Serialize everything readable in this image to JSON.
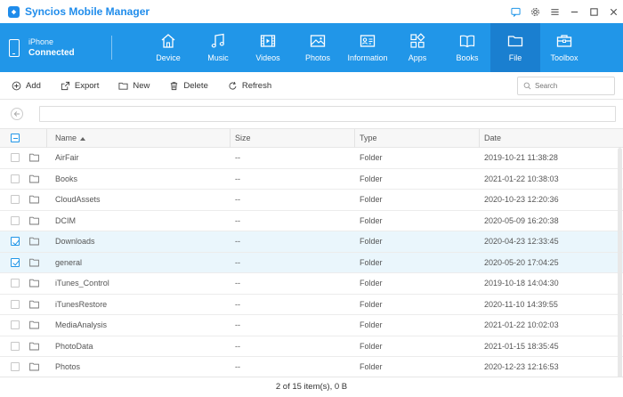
{
  "app": {
    "title": "Syncios Mobile Manager",
    "brand_color": "#1f8ceb",
    "nav_color": "#2196e8",
    "window_controls": [
      {
        "name": "chat-icon"
      },
      {
        "name": "gear-icon"
      },
      {
        "name": "menu-icon"
      },
      {
        "name": "minimize-icon"
      },
      {
        "name": "maximize-icon"
      },
      {
        "name": "close-icon"
      }
    ]
  },
  "device": {
    "name": "iPhone",
    "status": "Connected"
  },
  "tabs": [
    {
      "label": "Device",
      "icon": "home-icon"
    },
    {
      "label": "Music",
      "icon": "music-note-icon"
    },
    {
      "label": "Videos",
      "icon": "film-icon"
    },
    {
      "label": "Photos",
      "icon": "image-icon"
    },
    {
      "label": "Information",
      "icon": "contact-card-icon"
    },
    {
      "label": "Apps",
      "icon": "apps-grid-icon"
    },
    {
      "label": "Books",
      "icon": "book-icon"
    },
    {
      "label": "File",
      "icon": "folder-icon",
      "active": true
    },
    {
      "label": "Toolbox",
      "icon": "toolbox-icon"
    }
  ],
  "toolbar": {
    "add_label": "Add",
    "export_label": "Export",
    "new_label": "New",
    "delete_label": "Delete",
    "refresh_label": "Refresh",
    "search_placeholder": "Search"
  },
  "path": {
    "value": ""
  },
  "table": {
    "columns": {
      "name": "Name",
      "size": "Size",
      "type": "Type",
      "date": "Date"
    },
    "rows": [
      {
        "name": "AirFair",
        "size": "--",
        "type": "Folder",
        "date": "2019-10-21 11:38:28",
        "checked": false
      },
      {
        "name": "Books",
        "size": "--",
        "type": "Folder",
        "date": "2021-01-22 10:38:03",
        "checked": false
      },
      {
        "name": "CloudAssets",
        "size": "--",
        "type": "Folder",
        "date": "2020-10-23 12:20:36",
        "checked": false
      },
      {
        "name": "DCIM",
        "size": "--",
        "type": "Folder",
        "date": "2020-05-09 16:20:38",
        "checked": false
      },
      {
        "name": "Downloads",
        "size": "--",
        "type": "Folder",
        "date": "2020-04-23 12:33:45",
        "checked": true
      },
      {
        "name": "general",
        "size": "--",
        "type": "Folder",
        "date": "2020-05-20 17:04:25",
        "checked": true
      },
      {
        "name": "iTunes_Control",
        "size": "--",
        "type": "Folder",
        "date": "2019-10-18 14:04:30",
        "checked": false
      },
      {
        "name": "iTunesRestore",
        "size": "--",
        "type": "Folder",
        "date": "2020-11-10 14:39:55",
        "checked": false
      },
      {
        "name": "MediaAnalysis",
        "size": "--",
        "type": "Folder",
        "date": "2021-01-22 10:02:03",
        "checked": false
      },
      {
        "name": "PhotoData",
        "size": "--",
        "type": "Folder",
        "date": "2021-01-15 18:35:45",
        "checked": false
      },
      {
        "name": "Photos",
        "size": "--",
        "type": "Folder",
        "date": "2020-12-23 12:16:53",
        "checked": false
      }
    ]
  },
  "status": {
    "text": "2 of 15 item(s), 0 B"
  }
}
